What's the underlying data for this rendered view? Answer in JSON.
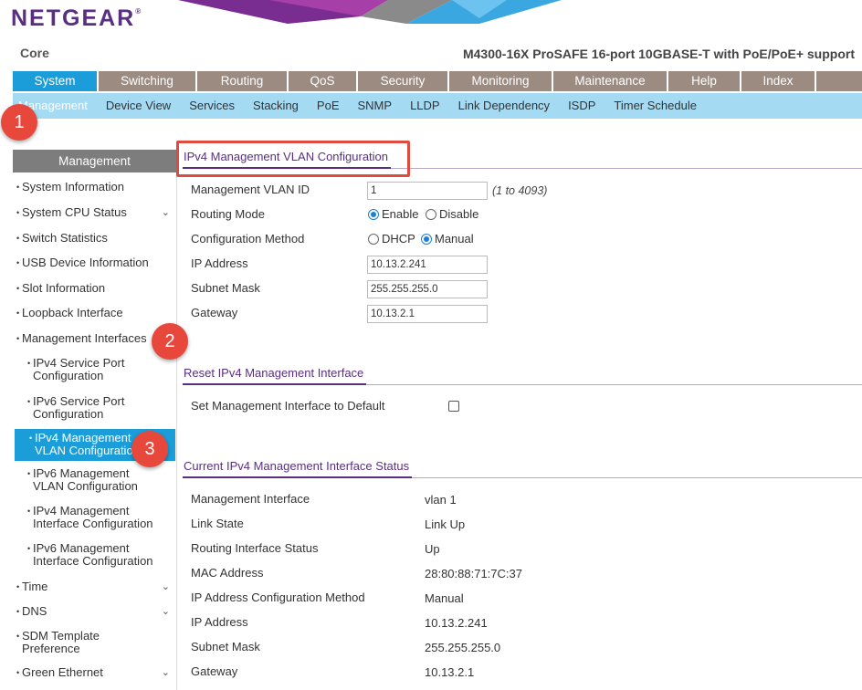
{
  "header": {
    "logo": "NETGEAR",
    "logo_mark": "®",
    "site": "Core",
    "model": "M4300-16X ProSAFE 16-port 10GBASE-T with PoE/PoE+ support"
  },
  "mainnav": [
    "System",
    "Switching",
    "Routing",
    "QoS",
    "Security",
    "Monitoring",
    "Maintenance",
    "Help",
    "Index"
  ],
  "subnav": [
    "Management",
    "Device View",
    "Services",
    "Stacking",
    "PoE",
    "SNMP",
    "LLDP",
    "Link Dependency",
    "ISDP",
    "Timer Schedule"
  ],
  "sidebar": {
    "title": "Management",
    "items": [
      {
        "label": "System Information"
      },
      {
        "label": "System CPU Status"
      },
      {
        "label": "Switch Statistics"
      },
      {
        "label": "USB Device Information"
      },
      {
        "label": "Slot Information"
      },
      {
        "label": "Loopback Interface"
      },
      {
        "label": "Management Interfaces"
      },
      {
        "label": "IPv4 Service Port Configuration"
      },
      {
        "label": "IPv6 Service Port Configuration"
      },
      {
        "label": "IPv4 Management VLAN Configuration"
      },
      {
        "label": "IPv6 Management VLAN Configuration"
      },
      {
        "label": "IPv4 Management Interface Configuration"
      },
      {
        "label": "IPv6 Management Interface Configuration"
      },
      {
        "label": "Time"
      },
      {
        "label": "DNS"
      },
      {
        "label": "SDM Template Preference"
      },
      {
        "label": "Green Ethernet"
      }
    ]
  },
  "config": {
    "title": "IPv4 Management VLAN Configuration",
    "vlan_label": "Management VLAN ID",
    "vlan_value": "1",
    "vlan_hint": "(1 to 4093)",
    "routing_label": "Routing Mode",
    "routing_enable": "Enable",
    "routing_disable": "Disable",
    "method_label": "Configuration Method",
    "method_dhcp": "DHCP",
    "method_manual": "Manual",
    "ip_label": "IP Address",
    "ip_value": "10.13.2.241",
    "mask_label": "Subnet Mask",
    "mask_value": "255.255.255.0",
    "gw_label": "Gateway",
    "gw_value": "10.13.2.1"
  },
  "reset": {
    "title": "Reset IPv4 Management Interface",
    "label": "Set Management Interface to Default"
  },
  "status": {
    "title": "Current IPv4 Management Interface Status",
    "rows": [
      {
        "label": "Management Interface",
        "value": "vlan 1"
      },
      {
        "label": "Link State",
        "value": "Link Up"
      },
      {
        "label": "Routing Interface Status",
        "value": "Up"
      },
      {
        "label": "MAC Address",
        "value": "28:80:88:71:7C:37"
      },
      {
        "label": "IP Address Configuration Method",
        "value": "Manual"
      },
      {
        "label": "IP Address",
        "value": "10.13.2.241"
      },
      {
        "label": "Subnet Mask",
        "value": "255.255.255.0"
      },
      {
        "label": "Gateway",
        "value": "10.13.2.1"
      }
    ]
  },
  "annotations": [
    "1",
    "2",
    "3"
  ],
  "colors": {
    "brand": "#5a2f82",
    "nav_active": "#1b9dd9",
    "subnav_bg": "#a5daf3",
    "callout": "#e8473c"
  }
}
